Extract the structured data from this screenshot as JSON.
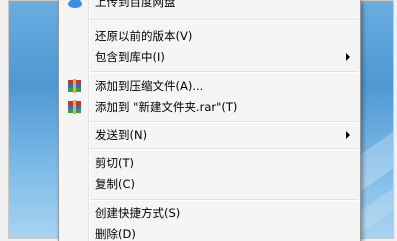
{
  "menu": {
    "items": [
      {
        "id": "upload",
        "label": "上传到百度网盘",
        "icon": "cloud-upload-icon",
        "top_partial": true
      },
      {
        "id": "restore",
        "label": "还原以前的版本(V)"
      },
      {
        "id": "include",
        "label": "包含到库中(I)",
        "submenu": true
      },
      {
        "id": "add-archive",
        "label": "添加到压缩文件(A)...",
        "icon": "winrar-icon"
      },
      {
        "id": "add-rar",
        "label": "添加到 \"新建文件夹.rar\"(T)",
        "icon": "winrar-icon"
      },
      {
        "id": "send-to",
        "label": "发送到(N)",
        "submenu": true
      },
      {
        "id": "cut",
        "label": "剪切(T)"
      },
      {
        "id": "copy",
        "label": "复制(C)"
      },
      {
        "id": "shortcut",
        "label": "创建快捷方式(S)"
      },
      {
        "id": "delete",
        "label": "删除(D)"
      }
    ]
  },
  "colors": {
    "menu_bg": "#f5f5f5",
    "desktop": "#4f98d3"
  }
}
